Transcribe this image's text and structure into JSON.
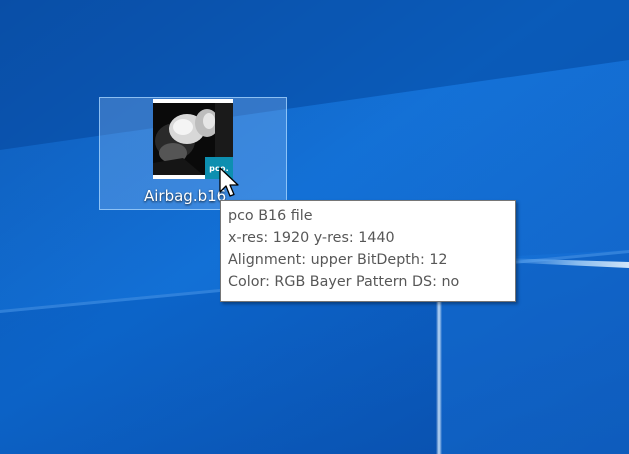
{
  "desktop": {
    "icon": {
      "label": "Airbag.b16",
      "badge_text": "pco.",
      "thumbnail": "crash-test-airbag-image",
      "selected": true
    },
    "tooltip": {
      "line1": "pco B16 file",
      "line2": "x-res: 1920  y-res: 1440",
      "line3": "Alignment: upper  BitDepth: 12",
      "line4": "Color: RGB Bayer Pattern  DS: no"
    },
    "cursor": "arrow-pointer-icon",
    "colors": {
      "wallpaper_base": "#0a5fc0",
      "selection_fill": "#a0cdff",
      "badge": "#0d8fb0",
      "tooltip_text": "#575757"
    }
  }
}
